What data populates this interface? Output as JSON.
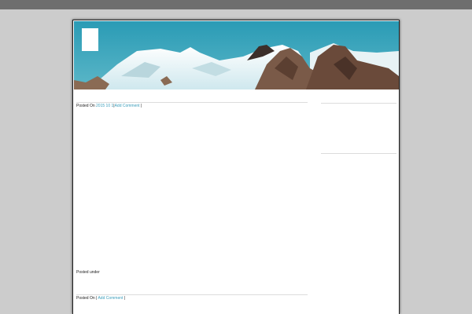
{
  "post1": {
    "posted_on_label": "Posted On",
    "year": "2015",
    "month": "10",
    "day_sep": "1",
    "comment_link": "Add Comment",
    "trailing_sep": "|"
  },
  "post1_footer": {
    "posted_under": "Posted under"
  },
  "post2": {
    "posted_on_label": "Posted On |",
    "comment_link": "Add Comment",
    "trailing_sep": "|"
  },
  "colors": {
    "background": "#cccccc",
    "topbar": "#6e6e6e",
    "link": "#3a9dbb",
    "sky": "#2a9bb5"
  }
}
